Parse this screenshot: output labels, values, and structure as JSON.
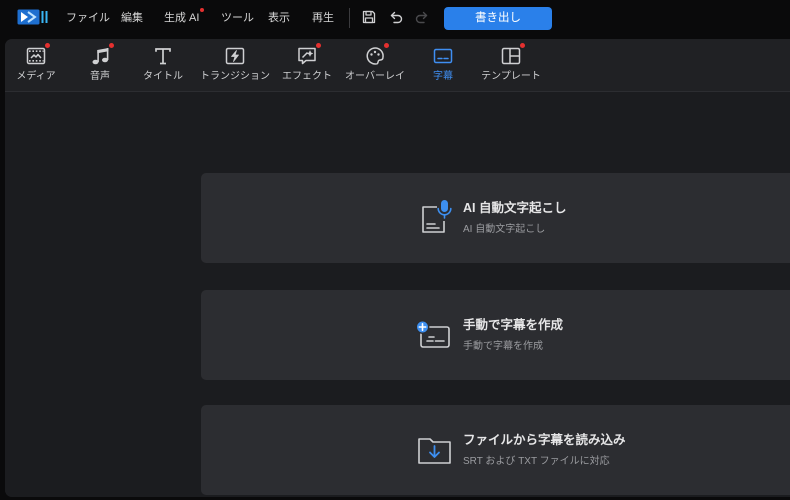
{
  "colors": {
    "accent": "#2a80ea",
    "badge": "#e5302f",
    "active": "#3f8ff2"
  },
  "app": {
    "logo_icon": "app-logo-icon"
  },
  "menu": {
    "items": [
      {
        "label": "ファイル",
        "badge": false
      },
      {
        "label": "編集",
        "badge": false
      },
      {
        "label": "生成 AI",
        "badge": true
      },
      {
        "label": "ツール",
        "badge": false
      },
      {
        "label": "表示",
        "badge": false
      },
      {
        "label": "再生",
        "badge": false
      }
    ]
  },
  "toolbar": {
    "save_icon": "save-icon",
    "undo_icon": "undo-icon",
    "redo_icon": "redo-icon",
    "redo_enabled": false,
    "export_label": "書き出し"
  },
  "tabs": [
    {
      "label": "メディア",
      "icon": "media-icon",
      "badge": true,
      "active": false
    },
    {
      "label": "音声",
      "icon": "music-note-icon",
      "badge": true,
      "active": false
    },
    {
      "label": "タイトル",
      "icon": "title-icon",
      "badge": false,
      "active": false
    },
    {
      "label": "トランジション",
      "icon": "transition-icon",
      "badge": false,
      "active": false
    },
    {
      "label": "エフェクト",
      "icon": "effect-icon",
      "badge": true,
      "active": false
    },
    {
      "label": "オーバーレイ",
      "icon": "overlay-icon",
      "badge": true,
      "active": false
    },
    {
      "label": "字幕",
      "icon": "subtitle-icon",
      "badge": false,
      "active": true
    },
    {
      "label": "テンプレート",
      "icon": "template-icon",
      "badge": true,
      "active": false
    }
  ],
  "subtitle_options": [
    {
      "title": "AI 自動文字起こし",
      "description": "AI 自動文字起こし",
      "icon": "ai-transcription-icon"
    },
    {
      "title": "手動で字幕を作成",
      "description": "手動で字幕を作成",
      "icon": "manual-subtitle-icon"
    },
    {
      "title": "ファイルから字幕を読み込み",
      "description": "SRT および TXT ファイルに対応",
      "icon": "import-subtitle-file-icon"
    }
  ]
}
